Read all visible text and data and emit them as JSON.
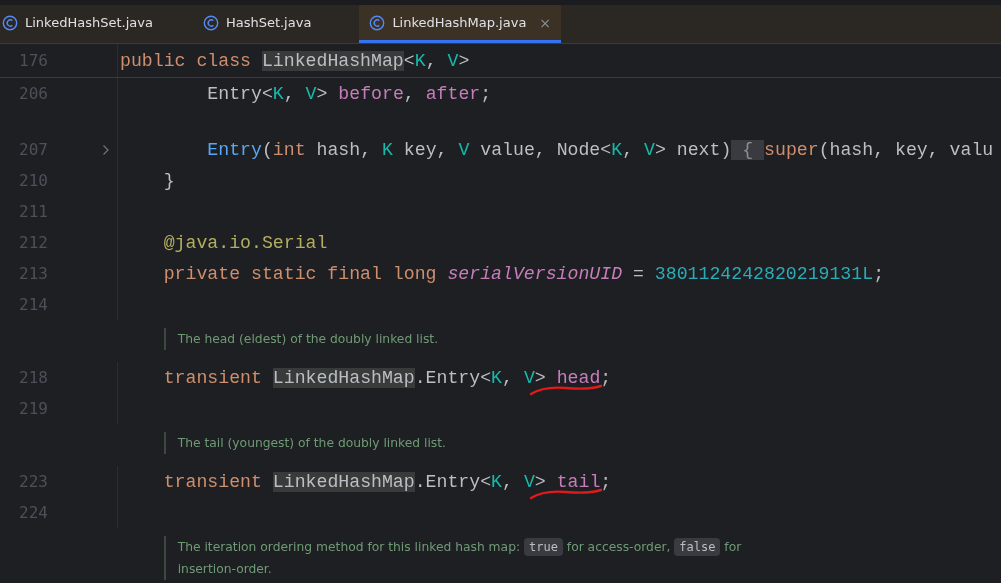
{
  "tabs": [
    {
      "label": "LinkedHashSet.java",
      "selected": false
    },
    {
      "label": "HashSet.java",
      "selected": false
    },
    {
      "label": "LinkedHashMap.java",
      "selected": true,
      "close": "×"
    }
  ],
  "sticky_line": {
    "number": "176",
    "tokens": [
      {
        "text": "public class ",
        "kind": "keyword"
      },
      {
        "text": "LinkedHashMap",
        "kind": "plain",
        "highlight": true
      },
      {
        "text": "<",
        "kind": "plain"
      },
      {
        "text": "K",
        "kind": "typeparam"
      },
      {
        "text": ", ",
        "kind": "plain"
      },
      {
        "text": "V",
        "kind": "typeparam"
      },
      {
        "text": ">",
        "kind": "plain"
      }
    ]
  },
  "rows": [
    {
      "kind": "code",
      "number": "206",
      "tokens": [
        {
          "text": "        Entry<",
          "kind": "plain"
        },
        {
          "text": "K",
          "kind": "typeparam"
        },
        {
          "text": ", ",
          "kind": "plain"
        },
        {
          "text": "V",
          "kind": "typeparam"
        },
        {
          "text": "> ",
          "kind": "plain"
        },
        {
          "text": "before",
          "kind": "field"
        },
        {
          "text": ", ",
          "kind": "plain"
        },
        {
          "text": "after",
          "kind": "field"
        },
        {
          "text": ";",
          "kind": "plain"
        }
      ]
    },
    {
      "kind": "blank"
    },
    {
      "kind": "code",
      "number": "207",
      "folded": true,
      "tokens": [
        {
          "text": "        Entry",
          "kind": "method"
        },
        {
          "text": "(",
          "kind": "plain"
        },
        {
          "text": "int",
          "kind": "keyword"
        },
        {
          "text": " hash, ",
          "kind": "plain"
        },
        {
          "text": "K",
          "kind": "typeparam"
        },
        {
          "text": " key, ",
          "kind": "plain"
        },
        {
          "text": "V",
          "kind": "typeparam"
        },
        {
          "text": " value, Node<",
          "kind": "plain"
        },
        {
          "text": "K",
          "kind": "typeparam"
        },
        {
          "text": ", ",
          "kind": "plain"
        },
        {
          "text": "V",
          "kind": "typeparam"
        },
        {
          "text": "> next)",
          "kind": "plain"
        },
        {
          "text": " { ",
          "kind": "fold",
          "highlight": true
        },
        {
          "text": "super",
          "kind": "keyword"
        },
        {
          "text": "(hash, key, valu",
          "kind": "plain"
        }
      ]
    },
    {
      "kind": "code",
      "number": "210",
      "tokens": [
        {
          "text": "    }",
          "kind": "plain"
        }
      ]
    },
    {
      "kind": "code",
      "number": "211",
      "tokens": []
    },
    {
      "kind": "code",
      "number": "212",
      "tokens": [
        {
          "text": "    @java.io.",
          "kind": "annotation"
        },
        {
          "text": "Serial",
          "kind": "annotation"
        }
      ]
    },
    {
      "kind": "code",
      "number": "213",
      "tokens": [
        {
          "text": "    private static final long ",
          "kind": "keyword"
        },
        {
          "text": "serialVersionUID",
          "kind": "constant"
        },
        {
          "text": " = ",
          "kind": "plain"
        },
        {
          "text": "3801124242820219131L",
          "kind": "number"
        },
        {
          "text": ";",
          "kind": "plain"
        }
      ]
    },
    {
      "kind": "code",
      "number": "214",
      "tokens": []
    },
    {
      "kind": "code",
      "number": "218",
      "doc": [
        {
          "text": "The head (eldest) of the doubly linked list.",
          "kind": "text"
        }
      ],
      "tokens": [
        {
          "text": "    transient ",
          "kind": "keyword"
        },
        {
          "text": "LinkedHashMap",
          "kind": "plain",
          "highlight": true
        },
        {
          "text": ".Entry<",
          "kind": "plain"
        },
        {
          "text": "K",
          "kind": "typeparam"
        },
        {
          "text": ", ",
          "kind": "plain"
        },
        {
          "text": "V",
          "kind": "typeparam"
        },
        {
          "text": "> ",
          "kind": "plain"
        },
        {
          "text": "head",
          "kind": "field",
          "underlined": true
        },
        {
          "text": ";",
          "kind": "plain"
        }
      ]
    },
    {
      "kind": "code",
      "number": "219",
      "tokens": []
    },
    {
      "kind": "code",
      "number": "223",
      "doc": [
        {
          "text": "The tail (youngest) of the doubly linked list.",
          "kind": "text"
        }
      ],
      "tokens": [
        {
          "text": "    transient ",
          "kind": "keyword"
        },
        {
          "text": "LinkedHashMap",
          "kind": "plain",
          "highlight": true
        },
        {
          "text": ".Entry<",
          "kind": "plain"
        },
        {
          "text": "K",
          "kind": "typeparam"
        },
        {
          "text": ", ",
          "kind": "plain"
        },
        {
          "text": "V",
          "kind": "typeparam"
        },
        {
          "text": "> ",
          "kind": "plain"
        },
        {
          "text": "tail",
          "kind": "field",
          "underlined": true
        },
        {
          "text": ";",
          "kind": "plain"
        }
      ]
    },
    {
      "kind": "code",
      "number": "224",
      "tokens": []
    },
    {
      "kind": "doc",
      "parts": [
        {
          "text": "The iteration ordering method for this linked hash map: ",
          "kind": "text"
        },
        {
          "text": "true",
          "kind": "code"
        },
        {
          "text": " for access-order, ",
          "kind": "text"
        },
        {
          "text": "false",
          "kind": "code"
        },
        {
          "text": " for insertion-order.",
          "kind": "text"
        }
      ]
    }
  ]
}
